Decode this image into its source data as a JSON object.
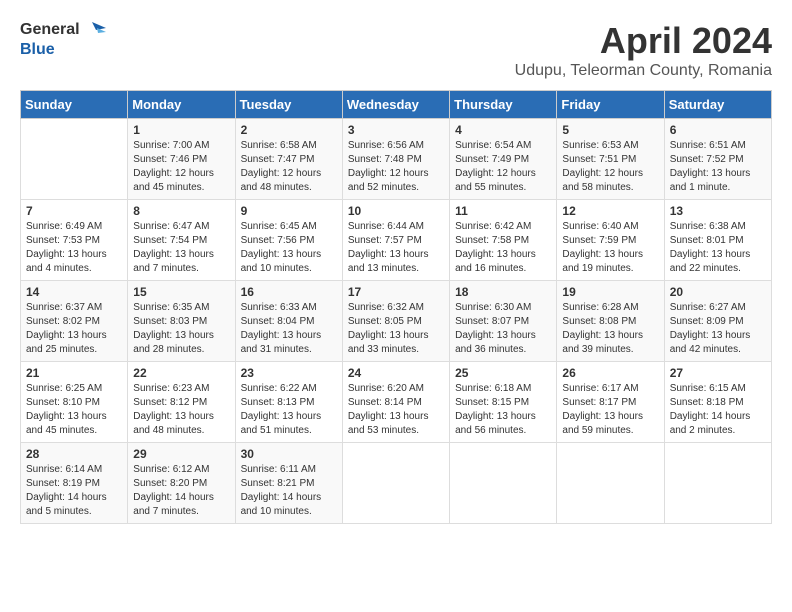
{
  "header": {
    "logo_general": "General",
    "logo_blue": "Blue",
    "title": "April 2024",
    "subtitle": "Udupu, Teleorman County, Romania"
  },
  "columns": [
    "Sunday",
    "Monday",
    "Tuesday",
    "Wednesday",
    "Thursday",
    "Friday",
    "Saturday"
  ],
  "weeks": [
    [
      {
        "day": "",
        "text": ""
      },
      {
        "day": "1",
        "text": "Sunrise: 7:00 AM\nSunset: 7:46 PM\nDaylight: 12 hours\nand 45 minutes."
      },
      {
        "day": "2",
        "text": "Sunrise: 6:58 AM\nSunset: 7:47 PM\nDaylight: 12 hours\nand 48 minutes."
      },
      {
        "day": "3",
        "text": "Sunrise: 6:56 AM\nSunset: 7:48 PM\nDaylight: 12 hours\nand 52 minutes."
      },
      {
        "day": "4",
        "text": "Sunrise: 6:54 AM\nSunset: 7:49 PM\nDaylight: 12 hours\nand 55 minutes."
      },
      {
        "day": "5",
        "text": "Sunrise: 6:53 AM\nSunset: 7:51 PM\nDaylight: 12 hours\nand 58 minutes."
      },
      {
        "day": "6",
        "text": "Sunrise: 6:51 AM\nSunset: 7:52 PM\nDaylight: 13 hours\nand 1 minute."
      }
    ],
    [
      {
        "day": "7",
        "text": "Sunrise: 6:49 AM\nSunset: 7:53 PM\nDaylight: 13 hours\nand 4 minutes."
      },
      {
        "day": "8",
        "text": "Sunrise: 6:47 AM\nSunset: 7:54 PM\nDaylight: 13 hours\nand 7 minutes."
      },
      {
        "day": "9",
        "text": "Sunrise: 6:45 AM\nSunset: 7:56 PM\nDaylight: 13 hours\nand 10 minutes."
      },
      {
        "day": "10",
        "text": "Sunrise: 6:44 AM\nSunset: 7:57 PM\nDaylight: 13 hours\nand 13 minutes."
      },
      {
        "day": "11",
        "text": "Sunrise: 6:42 AM\nSunset: 7:58 PM\nDaylight: 13 hours\nand 16 minutes."
      },
      {
        "day": "12",
        "text": "Sunrise: 6:40 AM\nSunset: 7:59 PM\nDaylight: 13 hours\nand 19 minutes."
      },
      {
        "day": "13",
        "text": "Sunrise: 6:38 AM\nSunset: 8:01 PM\nDaylight: 13 hours\nand 22 minutes."
      }
    ],
    [
      {
        "day": "14",
        "text": "Sunrise: 6:37 AM\nSunset: 8:02 PM\nDaylight: 13 hours\nand 25 minutes."
      },
      {
        "day": "15",
        "text": "Sunrise: 6:35 AM\nSunset: 8:03 PM\nDaylight: 13 hours\nand 28 minutes."
      },
      {
        "day": "16",
        "text": "Sunrise: 6:33 AM\nSunset: 8:04 PM\nDaylight: 13 hours\nand 31 minutes."
      },
      {
        "day": "17",
        "text": "Sunrise: 6:32 AM\nSunset: 8:05 PM\nDaylight: 13 hours\nand 33 minutes."
      },
      {
        "day": "18",
        "text": "Sunrise: 6:30 AM\nSunset: 8:07 PM\nDaylight: 13 hours\nand 36 minutes."
      },
      {
        "day": "19",
        "text": "Sunrise: 6:28 AM\nSunset: 8:08 PM\nDaylight: 13 hours\nand 39 minutes."
      },
      {
        "day": "20",
        "text": "Sunrise: 6:27 AM\nSunset: 8:09 PM\nDaylight: 13 hours\nand 42 minutes."
      }
    ],
    [
      {
        "day": "21",
        "text": "Sunrise: 6:25 AM\nSunset: 8:10 PM\nDaylight: 13 hours\nand 45 minutes."
      },
      {
        "day": "22",
        "text": "Sunrise: 6:23 AM\nSunset: 8:12 PM\nDaylight: 13 hours\nand 48 minutes."
      },
      {
        "day": "23",
        "text": "Sunrise: 6:22 AM\nSunset: 8:13 PM\nDaylight: 13 hours\nand 51 minutes."
      },
      {
        "day": "24",
        "text": "Sunrise: 6:20 AM\nSunset: 8:14 PM\nDaylight: 13 hours\nand 53 minutes."
      },
      {
        "day": "25",
        "text": "Sunrise: 6:18 AM\nSunset: 8:15 PM\nDaylight: 13 hours\nand 56 minutes."
      },
      {
        "day": "26",
        "text": "Sunrise: 6:17 AM\nSunset: 8:17 PM\nDaylight: 13 hours\nand 59 minutes."
      },
      {
        "day": "27",
        "text": "Sunrise: 6:15 AM\nSunset: 8:18 PM\nDaylight: 14 hours\nand 2 minutes."
      }
    ],
    [
      {
        "day": "28",
        "text": "Sunrise: 6:14 AM\nSunset: 8:19 PM\nDaylight: 14 hours\nand 5 minutes."
      },
      {
        "day": "29",
        "text": "Sunrise: 6:12 AM\nSunset: 8:20 PM\nDaylight: 14 hours\nand 7 minutes."
      },
      {
        "day": "30",
        "text": "Sunrise: 6:11 AM\nSunset: 8:21 PM\nDaylight: 14 hours\nand 10 minutes."
      },
      {
        "day": "",
        "text": ""
      },
      {
        "day": "",
        "text": ""
      },
      {
        "day": "",
        "text": ""
      },
      {
        "day": "",
        "text": ""
      }
    ]
  ]
}
